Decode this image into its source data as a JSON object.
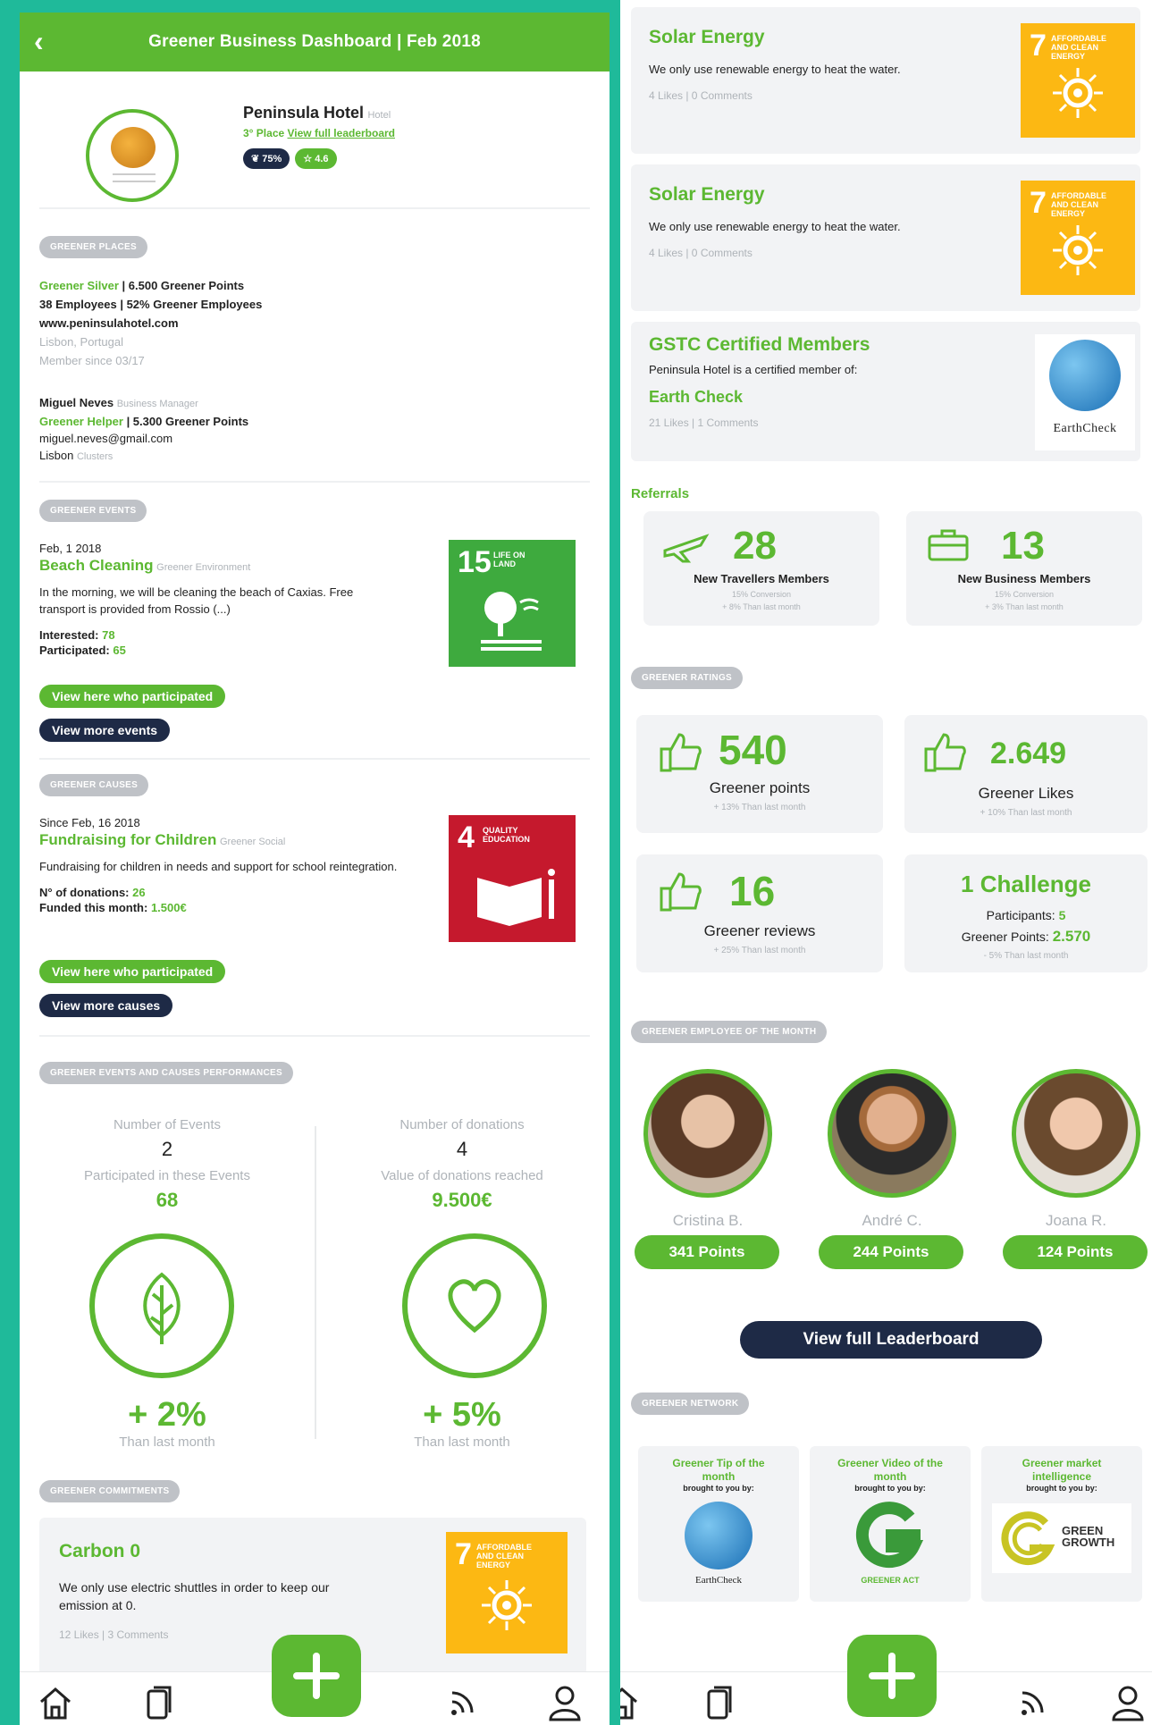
{
  "header": {
    "title": "Greener Business Dashboard | Feb 2018"
  },
  "hotel": {
    "name": "Peninsula Hotel",
    "type": "Hotel",
    "place": "3° Place",
    "leaderboard_link": "View full leaderboard",
    "badge_percent": "75%",
    "badge_rating": "4.6"
  },
  "places": {
    "section_label": "GREENER PLACES",
    "level": "Greener Silver",
    "points": "| 6.500 Greener Points",
    "employees": "38 Employees | 52% Greener Employees",
    "website": "www.peninsulahotel.com",
    "location": "Lisbon, Portugal",
    "member_since": "Member since 03/17",
    "manager_name": "Miguel Neves",
    "manager_role": "Business Manager",
    "helper_level": "Greener Helper",
    "helper_points": "| 5.300 Greener Points",
    "email": "miguel.neves@gmail.com",
    "city": "Lisbon",
    "city_suffix": "Clusters"
  },
  "events": {
    "section_label": "GREENER EVENTS",
    "date": "Feb, 1 2018",
    "title": "Beach Cleaning",
    "category": "Greener Environment",
    "description": "In the morning, we will be cleaning the beach of Caxias. Free transport is provided from Rossio (...)",
    "interested_label": "Interested:",
    "interested_value": "78",
    "participated_label": "Participated:",
    "participated_value": "65",
    "btn_participated": "View here who participated",
    "btn_more": "View more events",
    "sdg_num": "15",
    "sdg_caption": "LIFE ON LAND",
    "sdg_color": "#3eaa3e"
  },
  "causes": {
    "section_label": "GREENER CAUSES",
    "date": "Since Feb, 16 2018",
    "title": "Fundraising for Children",
    "category": "Greener Social",
    "description": "Fundraising for children in needs and support for school reintegration.",
    "donations_label": "N° of donations:",
    "donations_value": "26",
    "funded_label": "Funded this month:",
    "funded_value": "1.500€",
    "btn_participated": "View here who participated",
    "btn_more": "View more causes",
    "sdg_num": "4",
    "sdg_caption": "QUALITY EDUCATION",
    "sdg_color": "#c5192d"
  },
  "performance": {
    "section_label": "GREENER EVENTS AND CAUSES PERFORMANCES",
    "events_label": "Number of Events",
    "events_value": "2",
    "participated_label": "Participated in these Events",
    "participated_value": "68",
    "events_change": "+ 2%",
    "events_change_label": "Than last month",
    "donations_label": "Number of donations",
    "donations_value": "4",
    "reached_label": "Value of donations reached",
    "reached_value": "9.500€",
    "donations_change": "+ 5%",
    "donations_change_label": "Than last month"
  },
  "commitments": {
    "section_label": "GREENER COMMITMENTS",
    "title": "Carbon 0",
    "description": "We only use electric shuttles in order to keep our emission at 0.",
    "meta": "12 Likes | 3 Comments",
    "sdg_num": "7",
    "sdg_caption": "AFFORDABLE AND CLEAN ENERGY"
  },
  "right_cards": [
    {
      "title": "Solar Energy",
      "description": "We only use renewable energy to heat the water.",
      "meta": "4 Likes | 0 Comments"
    },
    {
      "title": "Solar Energy",
      "description": "We only use renewable energy to heat the water.",
      "meta": "4 Likes | 0 Comments"
    }
  ],
  "sdg7": {
    "num": "7",
    "caption": "AFFORDABLE AND CLEAN ENERGY",
    "color": "#fcb813"
  },
  "gstc": {
    "title": "GSTC Certified Members",
    "description": "Peninsula Hotel is a certified member of:",
    "member": "Earth Check",
    "meta": "21 Likes | 1 Comments",
    "logo_text": "EarthCheck"
  },
  "referrals": {
    "label": "Referrals",
    "travellers_value": "28",
    "travellers_label": "New Travellers Members",
    "travellers_conv": "15% Conversion",
    "travellers_change": "+ 8% Than last month",
    "business_value": "13",
    "business_label": "New Business Members",
    "business_conv": "15% Conversion",
    "business_change": "+ 3% Than last month"
  },
  "ratings": {
    "section_label": "GREENER RATINGS",
    "points_value": "540",
    "points_label": "Greener points",
    "points_change": "+ 13% Than last month",
    "likes_value": "2.649",
    "likes_label": "Greener Likes",
    "likes_change": "+ 10% Than last month",
    "reviews_value": "16",
    "reviews_label": "Greener reviews",
    "reviews_change": "+ 25% Than last month",
    "challenge_title": "1 Challenge",
    "challenge_participants_label": "Participants:",
    "challenge_participants": "5",
    "challenge_points_label": "Greener Points:",
    "challenge_points": "2.570",
    "challenge_change": "- 5% Than last month"
  },
  "employees": {
    "section_label": "GREENER EMPLOYEE OF THE MONTH",
    "list": [
      {
        "name": "Cristina B.",
        "points": "341 Points"
      },
      {
        "name": "André C.",
        "points": "244 Points"
      },
      {
        "name": "Joana R.",
        "points": "124 Points"
      }
    ],
    "leaderboard_btn": "View full Leaderboard"
  },
  "network": {
    "section_label": "GREENER NETWORK",
    "items": [
      {
        "title": "Greener Tip of the month",
        "sub": "brought to you by:",
        "logo": "EarthCheck"
      },
      {
        "title": "Greener Video of the month",
        "sub": "brought to you by:",
        "logo": "GREENER ACT"
      },
      {
        "title": "Greener market intelligence",
        "sub": "brought to you by:",
        "logo": "GREEN GROWTH"
      }
    ]
  },
  "colors": {
    "brand_green": "#5cb832",
    "navy": "#1e2a46",
    "frame_teal": "#1fba9a"
  }
}
